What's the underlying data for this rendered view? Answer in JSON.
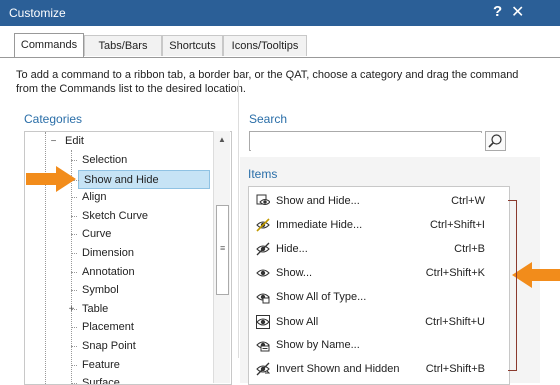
{
  "window": {
    "title": "Customize",
    "help": "?",
    "close": "✕"
  },
  "tabs": [
    "Commands",
    "Tabs/Bars",
    "Shortcuts",
    "Icons/Tooltips"
  ],
  "instructions": "To add a command to a ribbon tab, a border bar, or the QAT, choose a category and drag the command from the Commands list to the desired location.",
  "categories": {
    "label": "Categories",
    "parent": "Edit",
    "items": [
      "Selection",
      "Show and Hide",
      "Align",
      "Sketch Curve",
      "Curve",
      "Dimension",
      "Annotation",
      "Symbol",
      "Table",
      "Placement",
      "Snap Point",
      "Feature",
      "Surface"
    ],
    "selected": "Show and Hide"
  },
  "search": {
    "label": "Search",
    "placeholder": ""
  },
  "items": {
    "label": "Items",
    "list": [
      {
        "label": "Show and Hide...",
        "shortcut": "Ctrl+W",
        "icon": "show-hide-icon"
      },
      {
        "label": "Immediate Hide...",
        "shortcut": "Ctrl+Shift+I",
        "icon": "immediate-hide-icon"
      },
      {
        "label": "Hide...",
        "shortcut": "Ctrl+B",
        "icon": "hide-icon"
      },
      {
        "label": "Show...",
        "shortcut": "Ctrl+Shift+K",
        "icon": "show-icon"
      },
      {
        "label": "Show All of Type...",
        "shortcut": "",
        "icon": "show-all-type-icon"
      },
      {
        "label": "Show All",
        "shortcut": "Ctrl+Shift+U",
        "icon": "show-all-icon"
      },
      {
        "label": "Show by Name...",
        "shortcut": "",
        "icon": "show-by-name-icon"
      },
      {
        "label": "Invert Shown and Hidden",
        "shortcut": "Ctrl+Shift+B",
        "icon": "invert-icon"
      }
    ]
  },
  "colors": {
    "title_bar": "#2b5f97",
    "accent_text": "#2a6ea8",
    "selection": "#c6e3f5",
    "callout_arrow": "#f28c1b",
    "bracket": "#8a3a2e"
  }
}
